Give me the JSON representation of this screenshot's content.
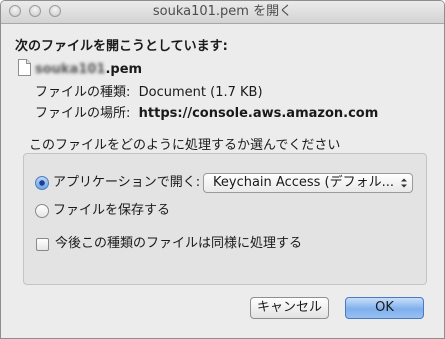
{
  "window": {
    "title": "souka101.pem を開く"
  },
  "heading": "次のファイルを開こうとしています:",
  "file": {
    "name_blurred": "souka101",
    "name_suffix": ".pem",
    "icon": "document-file-icon"
  },
  "info": {
    "type_label": "ファイルの種類:",
    "type_value": "Document (1.7 KB)",
    "location_label": "ファイルの場所:",
    "location_value": "https://console.aws.amazon.com"
  },
  "prompt": "このファイルをどのように処理するか選んでください",
  "options": {
    "open_with_label": "アプリケーションで開く:",
    "open_with_selected": true,
    "app_popup_value": "Keychain Access (デフォル...",
    "save_label": "ファイルを保存する",
    "save_selected": false,
    "remember_label": "今後この種類のファイルは同様に処理する",
    "remember_checked": false
  },
  "buttons": {
    "cancel": "キャンセル",
    "ok": "OK"
  },
  "colors": {
    "window_bg": "#ececec",
    "group_bg": "#e3e3e3",
    "default_button": "#7fb0ec",
    "radio_selected": "#6da3e6"
  }
}
